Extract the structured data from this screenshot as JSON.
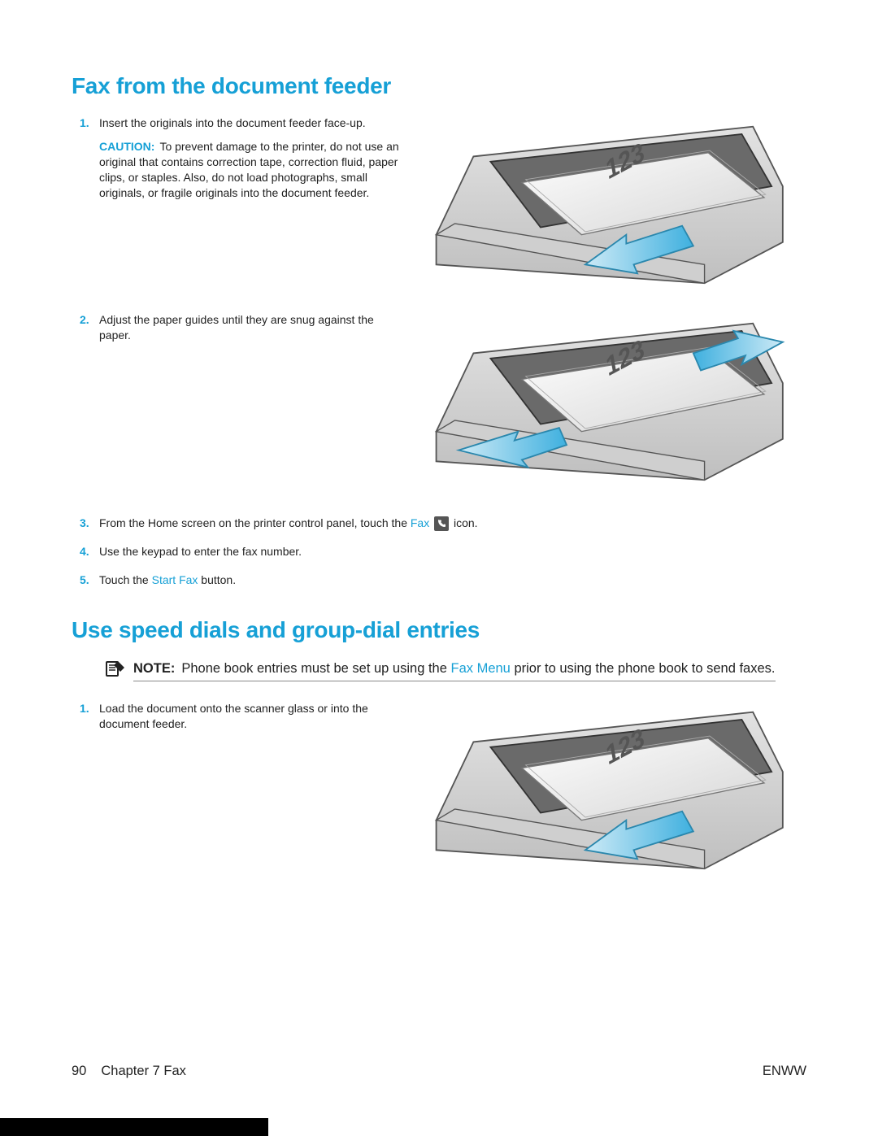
{
  "section1": {
    "title": "Fax from the document feeder",
    "step1_num": "1.",
    "step1_text": "Insert the originals into the document feeder face-up.",
    "caution_label": "CAUTION:",
    "caution_text": "To prevent damage to the printer, do not use an original that contains correction tape, correction fluid, paper clips, or staples. Also, do not load photographs, small originals, or fragile originals into the document feeder.",
    "step2_num": "2.",
    "step2_text": "Adjust the paper guides until they are snug against the paper.",
    "step3_num": "3.",
    "step3_a": "From the Home screen on the printer control panel, touch the ",
    "step3_fax": "Fax",
    "step3_b": " icon.",
    "step4_num": "4.",
    "step4_text": "Use the keypad to enter the fax number.",
    "step5_num": "5.",
    "step5_a": "Touch the ",
    "step5_link": "Start Fax",
    "step5_b": " button."
  },
  "section2": {
    "title": "Use speed dials and group-dial entries",
    "note_label": "NOTE:",
    "note_a": "Phone book entries must be set up using the ",
    "note_link": "Fax Menu",
    "note_b": " prior to using the phone book to send faxes.",
    "step1_num": "1.",
    "step1_text": "Load the document onto the scanner glass or into the document feeder."
  },
  "footer": {
    "page": "90",
    "chapter": "Chapter 7   Fax",
    "right": "ENWW"
  }
}
